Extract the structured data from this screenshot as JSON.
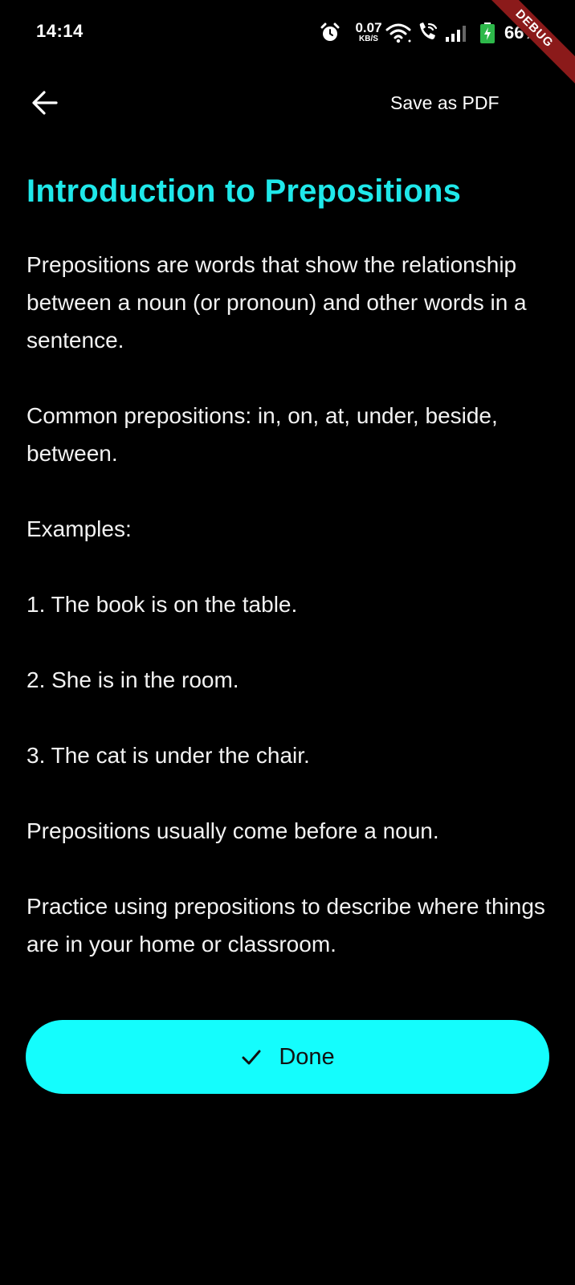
{
  "status_bar": {
    "time": "14:14",
    "net_speed_value": "0.07",
    "net_speed_unit": "KB/S",
    "battery": "66%",
    "icons": [
      "alarm-icon",
      "wifi-icon",
      "wifi-call-icon",
      "signal-icon",
      "battery-charging-icon"
    ]
  },
  "debug_banner": "DEBUG",
  "app_bar": {
    "back_icon": "arrow-back-icon",
    "save_pdf_label": "Save as PDF"
  },
  "lesson": {
    "title": "Introduction to Prepositions",
    "paragraphs": [
      "Prepositions are words that show the relationship between a noun (or pronoun) and other words in a sentence.",
      "Common prepositions: in, on, at, under, beside, between.",
      "Examples:",
      "1. The book is on the table.",
      "2. She is in the room.",
      "3. The cat is under the chair.",
      "Prepositions usually come before a noun.",
      "Practice using prepositions to describe where things are in your home or classroom."
    ]
  },
  "done_button": {
    "label": "Done",
    "icon": "check-icon"
  },
  "colors": {
    "background": "#000000",
    "title": "#1fe8ea",
    "done_button": "#14fdfd",
    "debug_ribbon": "#8b1a1a"
  }
}
